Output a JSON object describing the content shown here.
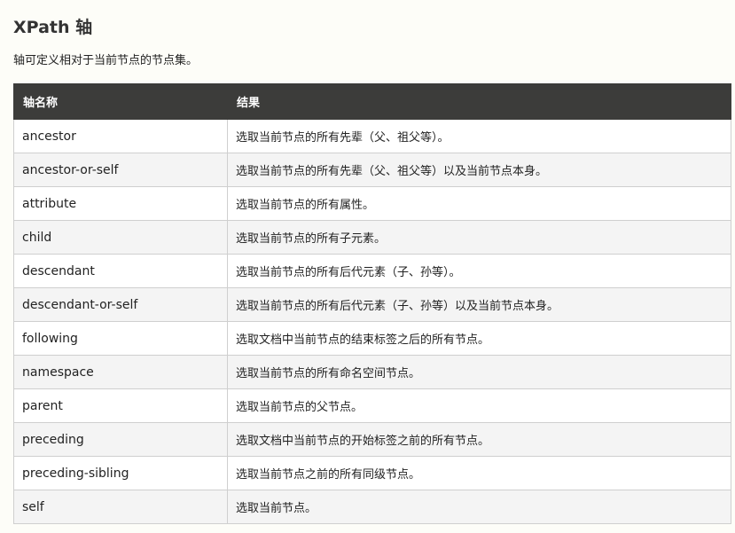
{
  "page": {
    "title": "XPath 轴",
    "intro": "轴可定义相对于当前节点的节点集。"
  },
  "table": {
    "headers": [
      "轴名称",
      "结果"
    ],
    "rows": [
      {
        "name": "ancestor",
        "result": "选取当前节点的所有先辈（父、祖父等）。"
      },
      {
        "name": "ancestor-or-self",
        "result": "选取当前节点的所有先辈（父、祖父等）以及当前节点本身。"
      },
      {
        "name": "attribute",
        "result": "选取当前节点的所有属性。"
      },
      {
        "name": "child",
        "result": "选取当前节点的所有子元素。"
      },
      {
        "name": "descendant",
        "result": "选取当前节点的所有后代元素（子、孙等）。"
      },
      {
        "name": "descendant-or-self",
        "result": "选取当前节点的所有后代元素（子、孙等）以及当前节点本身。"
      },
      {
        "name": "following",
        "result": "选取文档中当前节点的结束标签之后的所有节点。"
      },
      {
        "name": "namespace",
        "result": "选取当前节点的所有命名空间节点。"
      },
      {
        "name": "parent",
        "result": "选取当前节点的父节点。"
      },
      {
        "name": "preceding",
        "result": "选取文档中当前节点的开始标签之前的所有节点。"
      },
      {
        "name": "preceding-sibling",
        "result": "选取当前节点之前的所有同级节点。"
      },
      {
        "name": "self",
        "result": "选取当前节点。"
      }
    ]
  },
  "colors": {
    "header_bg": "#3c3c3a",
    "header_text": "#ffffff",
    "row_alt_bg": "#f4f4f4",
    "page_bg": "#fdfdf8"
  }
}
